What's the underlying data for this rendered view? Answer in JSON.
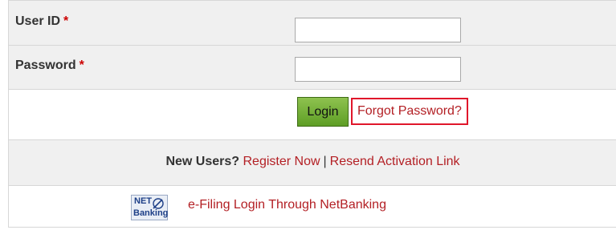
{
  "user_id": {
    "label": "User ID",
    "required_mark": "*",
    "value": ""
  },
  "password": {
    "label": "Password",
    "required_mark": "*",
    "value": ""
  },
  "actions": {
    "login_label": "Login",
    "forgot_label": "Forgot Password?"
  },
  "new_users": {
    "prefix": "New Users?",
    "register_label": "Register Now",
    "separator": "|",
    "resend_label": "Resend Activation Link"
  },
  "netbanking": {
    "logo_line1": "NET",
    "logo_line2": "Banking",
    "logo_icon": "pen-icon",
    "link_label": "e-Filing Login Through NetBanking"
  },
  "colors": {
    "link": "#b31f24",
    "required": "#cc0000",
    "login_button": "#6fae32",
    "highlight_border": "#e0162b",
    "row_grey": "#f0f0f0"
  }
}
